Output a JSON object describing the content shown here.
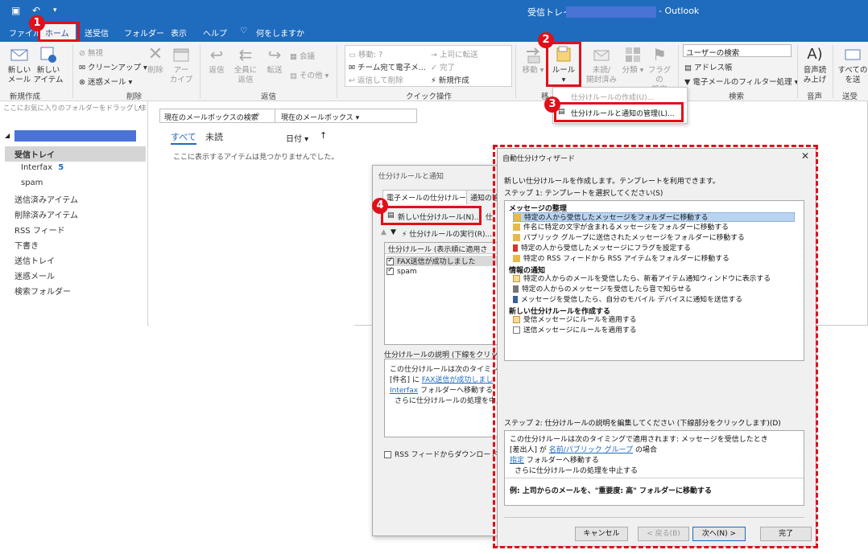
{
  "titlebar": {
    "title_left": "受信トレイ - ",
    "title_right": "- Outlook"
  },
  "menubar": {
    "items": [
      "ファイル",
      "ホーム",
      "送受信",
      "フォルダー",
      "表示",
      "ヘルプ",
      "何をしますか"
    ],
    "active_index": 1
  },
  "ribbon": {
    "new_mail": "新しい\nメール",
    "new_items": "新しい\nアイテム",
    "group_new": "新規作成",
    "ignore": "無視",
    "cleanup": "クリーンアップ",
    "junk": "迷惑メール",
    "delete": "削除",
    "archive": "アー\nカイブ",
    "group_delete": "削除",
    "reply": "返信",
    "reply_all": "全員に\n返信",
    "forward": "転送",
    "meeting": "会議",
    "more": "その他",
    "group_respond": "返信",
    "qs_move": "移動: ?",
    "qs_to_manager": "上司に転送",
    "qs_team_email": "チーム宛て電子メ...",
    "qs_done": "完了",
    "qs_reply_delete": "返信して削除",
    "qs_create_new": "新規作成",
    "group_quicksteps": "クイック操作",
    "move": "移動",
    "rules": "ルール",
    "unread_read": "未読/\n開封済み",
    "categorize": "分類",
    "follow_up": "フラグの\n設定",
    "search_people": "ユーザーの検索",
    "address_book": "アドレス帳",
    "filter_email": "電子メールのフィルター処理",
    "group_search": "検索",
    "read_aloud": "音声読\nみ上げ",
    "group_speech": "音声",
    "send_receive_all": "すべての\nを送",
    "group_sendreceive": "送受",
    "group_move_short": "移"
  },
  "rules_dropdown": {
    "create_rule": "仕分けルールの作成(U)...",
    "manage_rules": "仕分けルールと通知の管理(L)..."
  },
  "folders": {
    "hint": "ここにお気に入りのフォルダーをドラッグしま",
    "inbox": "受信トレイ",
    "interfax": "Interfax",
    "interfax_count": "5",
    "spam": "spam",
    "sent": "送信済みアイテム",
    "deleted": "削除済みアイテム",
    "rss": "RSS フィード",
    "drafts": "下書き",
    "outbox": "送信トレイ",
    "junk": "迷惑メール",
    "search": "検索フォルダー"
  },
  "msglist": {
    "search_placeholder": "現在のメールボックスの検索",
    "scope": "現在のメールボックス",
    "tab_all": "すべて",
    "tab_unread": "未読",
    "sort": "日付",
    "empty": "ここに表示するアイテムは見つかりませんでした。"
  },
  "rules_dialog": {
    "title": "仕分けルールと通知",
    "tab_email_rules": "電子メールの仕分けルール",
    "tab_alerts": "通知の管",
    "new_rule": "新しい仕分けルール(N)...",
    "change": "仕",
    "run_rules": "仕分けルールの実行(R)...",
    "col_header": "仕分けルール (表示順に適用さ",
    "rules": [
      {
        "name": "FAX送信が成功しました",
        "checked": true
      },
      {
        "name": "spam",
        "checked": true
      }
    ],
    "desc_label": "仕分けルールの説明 (下線をクリック",
    "desc_line1": "この仕分けルールは次のタイミングで",
    "desc_line2_prefix": "[件名] に ",
    "desc_line2_link": "FAX送信が成功しまし",
    "desc_line3_link": "Interfax",
    "desc_line3_suffix": " フォルダーへ移動する",
    "desc_line4": "さらに仕分けルールの処理を中止",
    "rss_option": "RSS フィードからダウンロードされた"
  },
  "wizard": {
    "title": "自動仕分けウィザード",
    "close": "✕",
    "intro": "新しい仕分けルールを作成します。テンプレートを利用できます。",
    "step1": "ステップ 1: テンプレートを選択してください(S)",
    "cat_organize": "メッセージの整理",
    "items_organize": [
      "特定の人から受信したメッセージをフォルダーに移動する",
      "件名に特定の文字が含まれるメッセージをフォルダーに移動する",
      "パブリック グループに送信されたメッセージをフォルダーに移動する",
      "特定の人から受信したメッセージにフラグを設定する",
      "特定の RSS フィードから RSS アイテムをフォルダーに移動する"
    ],
    "cat_notify": "情報の通知",
    "items_notify": [
      "特定の人からのメールを受信したら、新着アイテム通知ウィンドウに表示する",
      "特定の人からのメッセージを受信したら音で知らせる",
      "メッセージを受信したら、自分のモバイル デバイスに通知を送信する"
    ],
    "cat_blank": "新しい仕分けルールを作成する",
    "items_blank": [
      "受信メッセージにルールを適用する",
      "送信メッセージにルールを適用する"
    ],
    "step2": "ステップ 2: 仕分けルールの説明を編集してください (下線部分をクリックします)(D)",
    "desc_line1": "この仕分けルールは次のタイミングで適用されます: メッセージを受信したとき",
    "desc_line2_prefix": "[差出人] が ",
    "desc_line2_link": "名前/パブリック グループ",
    "desc_line2_suffix": " の場合",
    "desc_line3_link": "指定",
    "desc_line3_suffix": " フォルダーへ移動する",
    "desc_line4": "さらに仕分けルールの処理を中止する",
    "example": "例: 上司からのメールを、\"重要度: 高\" フォルダーに移動する",
    "btn_cancel": "キャンセル",
    "btn_back": "< 戻る(B)",
    "btn_next": "次へ(N) >",
    "btn_finish": "完了"
  },
  "annotations": {
    "step1": "1",
    "step2": "2",
    "step3": "3",
    "step4": "4",
    "color": "#e0101a"
  },
  "colors": {
    "titlebar": "#1f6bbd",
    "redaction": "#4a73d6",
    "selection": "#b9d4f1"
  }
}
